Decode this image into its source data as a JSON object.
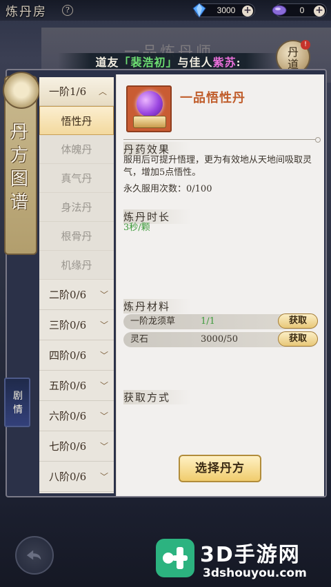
{
  "topbar": {
    "room_title": "炼丹房",
    "help_icon": "?",
    "currency_1": {
      "amount": "3000",
      "icon": "blue-gem-icon"
    },
    "currency_2": {
      "amount": "0",
      "icon": "purple-gem-icon"
    },
    "plus": "+"
  },
  "banner": {
    "faded_title": "一品炼丹师",
    "prefix": "道友",
    "name_1": "「裴浩初」",
    "middle": "与佳人",
    "name_2": "紫苏",
    "suffix": ":",
    "emblem_text": "丹道",
    "emblem_badge": "!"
  },
  "side": {
    "title": "丹方图谱",
    "story_label": "剧情"
  },
  "tiers": {
    "open_tier": {
      "label": "一阶1/6"
    },
    "pills": [
      {
        "label": "悟性丹",
        "active": true
      },
      {
        "label": "体魄丹",
        "active": false
      },
      {
        "label": "真气丹",
        "active": false
      },
      {
        "label": "身法丹",
        "active": false
      },
      {
        "label": "根骨丹",
        "active": false
      },
      {
        "label": "机缘丹",
        "active": false
      }
    ],
    "rows": [
      {
        "label": "二阶0/6"
      },
      {
        "label": "三阶0/6"
      },
      {
        "label": "四阶0/6"
      },
      {
        "label": "五阶0/6"
      },
      {
        "label": "六阶0/6"
      },
      {
        "label": "七阶0/6"
      },
      {
        "label": "八阶0/6"
      }
    ]
  },
  "detail": {
    "pill_name": "一品悟性丹",
    "effect_title": "丹药效果",
    "effect_text": "服用后可提升悟理，更为有效地从天地间吸取灵气，增加5点悟性。",
    "uses": "永久服用次数：0/100",
    "time_title": "炼丹时长",
    "time_value": "3秒/颗",
    "materials_title": "炼丹材料",
    "materials": [
      {
        "name": "一阶龙须草",
        "count": "1/1",
        "button": "获取"
      },
      {
        "name": "灵石",
        "count": "3000/50",
        "button": "获取"
      }
    ],
    "obtain_title": "获取方式",
    "select_button": "选择丹方"
  },
  "watermark": {
    "name": "3D手游网",
    "url": "3dshouyou.com"
  },
  "colors": {
    "accent_gold": "#f0cc6d",
    "pill_name": "#c05d2b",
    "green": "#3c9a3a",
    "pink": "#e86fd9"
  }
}
